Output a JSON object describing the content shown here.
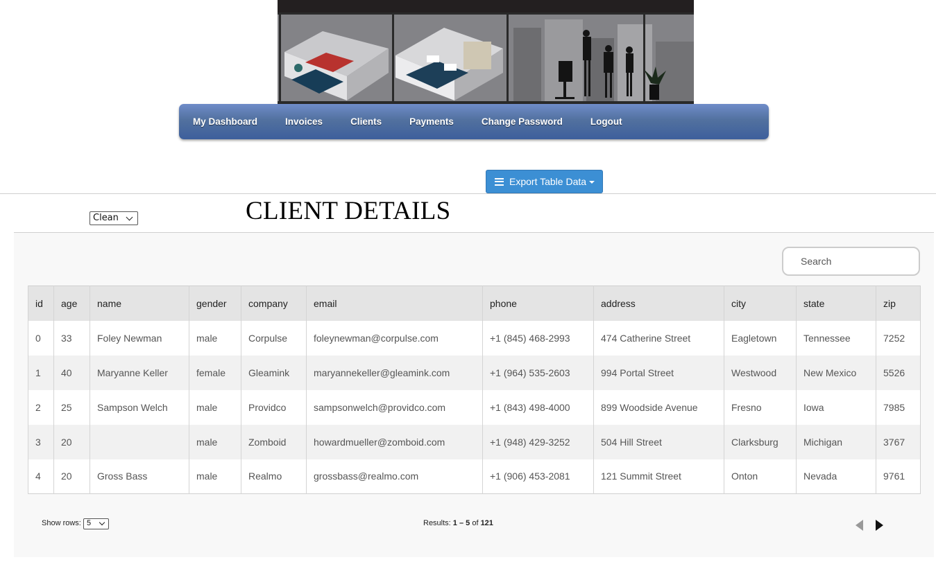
{
  "nav": {
    "items": [
      "My Dashboard",
      "Invoices",
      "Clients",
      "Payments",
      "Change Password",
      "Logout"
    ]
  },
  "toolbar": {
    "export_label": "Export Table Data"
  },
  "theme_select": {
    "selected": "Clean"
  },
  "page_title": "CLIENT DETAILS",
  "search": {
    "placeholder": "Search"
  },
  "table": {
    "columns": [
      "id",
      "age",
      "name",
      "gender",
      "company",
      "email",
      "phone",
      "address",
      "city",
      "state",
      "zip"
    ],
    "rows": [
      [
        "0",
        "33",
        "Foley Newman",
        "male",
        "Corpulse",
        "foleynewman@corpulse.com",
        "+1 (845) 468-2993",
        "474 Catherine Street",
        "Eagletown",
        "Tennessee",
        "7252"
      ],
      [
        "1",
        "40",
        "Maryanne Keller",
        "female",
        "Gleamink",
        "maryannekeller@gleamink.com",
        "+1 (964) 535-2603",
        "994 Portal Street",
        "Westwood",
        "New Mexico",
        "5526"
      ],
      [
        "2",
        "25",
        "Sampson Welch",
        "male",
        "Providco",
        "sampsonwelch@providco.com",
        "+1 (843) 498-4000",
        "899 Woodside Avenue",
        "Fresno",
        "Iowa",
        "7985"
      ],
      [
        "3",
        "20",
        "",
        "male",
        "Zomboid",
        "howardmueller@zomboid.com",
        "+1 (948) 429-3252",
        "504 Hill Street",
        "Clarksburg",
        "Michigan",
        "3767"
      ],
      [
        "4",
        "20",
        "Gross Bass",
        "male",
        "Realmo",
        "grossbass@realmo.com",
        "+1 (906) 453-2081",
        "121 Summit Street",
        "Onton",
        "Nevada",
        "9761"
      ]
    ]
  },
  "pagination": {
    "show_rows_label": "Show rows:",
    "rows_per_page": "5",
    "results_prefix": "Results: ",
    "range": "1 – 5",
    "of_label": " of ",
    "total": "121"
  },
  "colors": {
    "nav_gradient_top": "#6f8cc9",
    "nav_gradient_bottom": "#3d5f9c",
    "export_button": "#3c8fd4",
    "table_header_bg": "#e4e4e4",
    "panel_bg": "#f8f8f8"
  }
}
